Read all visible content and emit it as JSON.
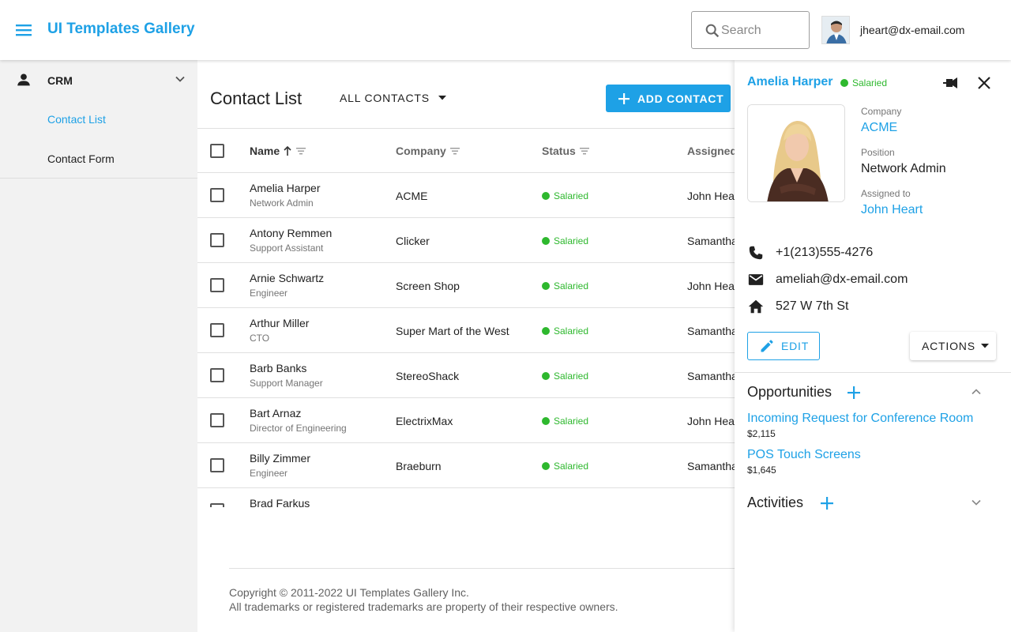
{
  "header": {
    "app_title": "UI Templates Gallery",
    "search_placeholder": "Search",
    "user_email": "jheart@dx-email.com"
  },
  "sidebar": {
    "group_label": "CRM",
    "items": [
      {
        "label": "Contact List",
        "active": true
      },
      {
        "label": "Contact Form",
        "active": false
      }
    ]
  },
  "main": {
    "title": "Contact List",
    "filter_label": "ALL CONTACTS",
    "add_button_label": "ADD CONTACT",
    "columns": [
      "Name",
      "Company",
      "Status",
      "Assigned"
    ],
    "rows": [
      {
        "name": "Amelia Harper",
        "position": "Network Admin",
        "company": "ACME",
        "status": "Salaried",
        "assigned": "John Heart"
      },
      {
        "name": "Antony Remmen",
        "position": "Support Assistant",
        "company": "Clicker",
        "status": "Salaried",
        "assigned": "Samantha Bright"
      },
      {
        "name": "Arnie Schwartz",
        "position": "Engineer",
        "company": "Screen Shop",
        "status": "Salaried",
        "assigned": "John Heart"
      },
      {
        "name": "Arthur Miller",
        "position": "CTO",
        "company": "Super Mart of the West",
        "status": "Salaried",
        "assigned": "Samantha Bright"
      },
      {
        "name": "Barb Banks",
        "position": "Support Manager",
        "company": "StereoShack",
        "status": "Salaried",
        "assigned": "Samantha Bright"
      },
      {
        "name": "Bart Arnaz",
        "position": "Director of Engineering",
        "company": "ElectrixMax",
        "status": "Salaried",
        "assigned": "John Heart"
      },
      {
        "name": "Billy Zimmer",
        "position": "Engineer",
        "company": "Braeburn",
        "status": "Salaried",
        "assigned": "Samantha Bright"
      },
      {
        "name": "Brad Farkus",
        "position": "",
        "company": "",
        "status": "",
        "assigned": ""
      }
    ],
    "footer_line1": "Copyright © 2011-2022 UI Templates Gallery Inc.",
    "footer_line2": "All trademarks or registered trademarks are property of their respective owners."
  },
  "panel": {
    "name": "Amelia Harper",
    "status": "Salaried",
    "company_label": "Company",
    "company": "ACME",
    "position_label": "Position",
    "position": "Network Admin",
    "assigned_label": "Assigned to",
    "assigned": "John Heart",
    "phone": "+1(213)555-4276",
    "email": "ameliah@dx-email.com",
    "address": "527 W 7th St",
    "edit_label": "EDIT",
    "actions_label": "ACTIONS",
    "opportunities_title": "Opportunities",
    "opportunities": [
      {
        "title": "Incoming Request for Conference Room",
        "amount": "$2,115"
      },
      {
        "title": "POS Touch Screens",
        "amount": "$1,645"
      }
    ],
    "activities_title": "Activities"
  },
  "colors": {
    "accent": "#1ea1e6",
    "status_green": "#2eb82e"
  }
}
